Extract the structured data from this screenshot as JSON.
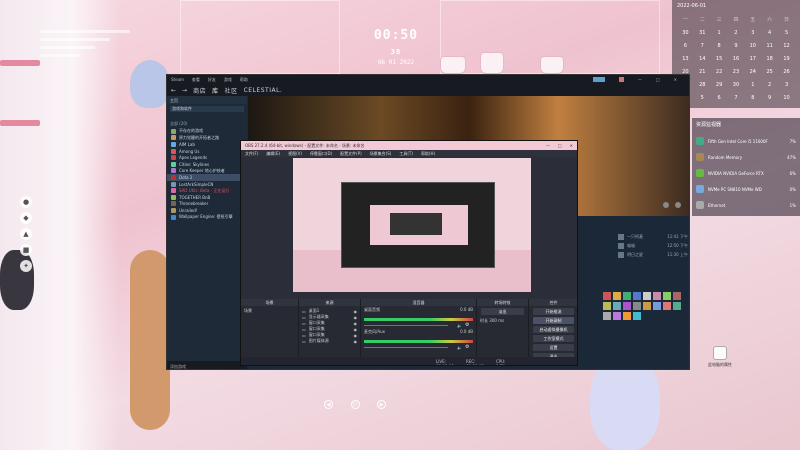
{
  "desktop": {
    "clock_time": "00:50",
    "clock_seconds": "38",
    "clock_date": "06 01 2022",
    "icons": [
      "app-icon",
      "app-icon",
      "app-icon",
      "app-icon",
      "app-icon",
      "app-icon"
    ]
  },
  "calendar": {
    "header": "2022-06-01",
    "weekdays": [
      "一",
      "二",
      "三",
      "四",
      "五",
      "六",
      "日"
    ],
    "weeks": [
      [
        "30",
        "31",
        "1",
        "2",
        "3",
        "4",
        "5"
      ],
      [
        "6",
        "7",
        "8",
        "9",
        "10",
        "11",
        "12"
      ],
      [
        "13",
        "14",
        "15",
        "16",
        "17",
        "18",
        "19"
      ],
      [
        "20",
        "21",
        "22",
        "23",
        "24",
        "25",
        "26"
      ],
      [
        "27",
        "28",
        "29",
        "30",
        "1",
        "2",
        "3"
      ],
      [
        "4",
        "5",
        "6",
        "7",
        "8",
        "9",
        "10"
      ]
    ]
  },
  "sysmon": {
    "title": "资源监视器",
    "rows": [
      {
        "name": "Fifth Gen Intel Core i5 11600F",
        "value": "7%"
      },
      {
        "name": "Random Memory",
        "value": "47%"
      },
      {
        "name": "NVIDIA NVIDIA GeForce RTX",
        "value": "6%"
      },
      {
        "name": "NVMe PC SN810 NVMe WD",
        "value": "0%"
      },
      {
        "name": "Ethernet",
        "value": "1%"
      }
    ]
  },
  "shortcut": {
    "label": "此电脑的属性"
  },
  "steam": {
    "titlebar": [
      "Steam",
      "查看",
      "好友",
      "游戏",
      "帮助"
    ],
    "nav": {
      "back": "←",
      "forward": "→",
      "store": "商店",
      "library": "库",
      "community": "社区",
      "username": "CELESTIAL."
    },
    "sidebar_header": "主页",
    "sidebar_search": "游戏和软件",
    "games_header": "全部 (20)",
    "games": [
      {
        "name": "不存在的游戏",
        "sel": false,
        "red": false
      },
      {
        "name": "原力觉醒的开拓者之路",
        "sel": false,
        "red": false
      },
      {
        "name": "AIM Lab",
        "sel": false,
        "red": false
      },
      {
        "name": "Among Us",
        "sel": false,
        "red": false
      },
      {
        "name": "Apex Legends",
        "sel": false,
        "red": false
      },
      {
        "name": "Cities: Skylines",
        "sel": false,
        "red": false
      },
      {
        "name": "Core Keeper 地心护核者",
        "sel": false,
        "red": false
      },
      {
        "name": "Dota 2",
        "sel": true,
        "red": false
      },
      {
        "name": "LostArkSimpleCN",
        "sel": false,
        "red": false
      },
      {
        "name": "SAO Utils: Beta - 正在运行",
        "sel": false,
        "red": true
      },
      {
        "name": "TOGETHER BnB",
        "sel": false,
        "red": false
      },
      {
        "name": "Thronebreaker",
        "sel": false,
        "red": false
      },
      {
        "name": "Unrailed!",
        "sel": false,
        "red": false
      },
      {
        "name": "Wallpaper Engine: 壁纸引擎",
        "sel": false,
        "red": false
      }
    ],
    "add_game": "添加游戏",
    "friends": [
      {
        "name": "一只柯基",
        "time": "11:41 下午"
      },
      {
        "name": "喵喵",
        "time": "12:50 下午"
      },
      {
        "name": "明日之星",
        "time": "11:30 上午"
      }
    ]
  },
  "obs": {
    "title": "OBS 27.2.4 (64-bit, windows) - 配置文件: 未命名 - 场景: 未命名",
    "menu": [
      "文件(F)",
      "编辑(E)",
      "视图(V)",
      "停靠窗口(D)",
      "配置文件(P)",
      "场景集合(S)",
      "工具(T)",
      "帮助(H)"
    ],
    "scenes_header": "场景",
    "scenes": [
      "场景"
    ],
    "sources_header": "来源",
    "sources": [
      "桌面1",
      "显示器采集",
      "窗口采集",
      "窗口采集",
      "窗口采集",
      "图片媒体源"
    ],
    "mixer_header": "混音器",
    "mixer": [
      {
        "name": "桌面音频",
        "level": "0.0 dB"
      },
      {
        "name": "麦克风/Aux",
        "level": "0.0 dB"
      }
    ],
    "transitions_header": "转场特效",
    "transition_value": "淡出",
    "duration_label": "时长",
    "duration_value": "300 ms",
    "controls_header": "控件",
    "controls": [
      "开始推流",
      "开始录制",
      "启动虚拟摄像机",
      "工作室模式",
      "设置",
      "退出"
    ],
    "status": {
      "live": "LIVE: 00:00:00",
      "rec": "REC: 00:00:00",
      "cpu": "CPU: 0.7%, 60.00 fps"
    }
  }
}
